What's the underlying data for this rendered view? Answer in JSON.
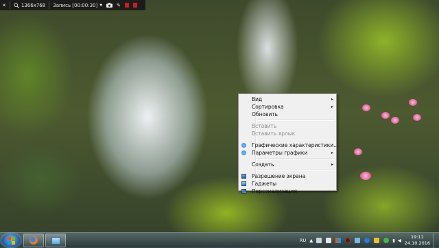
{
  "recorder": {
    "resolution": "1366x768",
    "record_label": "Запись [00:00:30]"
  },
  "context_menu": {
    "items": [
      {
        "label": "Вид",
        "submenu": true,
        "enabled": true
      },
      {
        "label": "Сортировка",
        "submenu": true,
        "enabled": true
      },
      {
        "label": "Обновить",
        "enabled": true
      },
      {
        "label": "Вставить",
        "enabled": false
      },
      {
        "label": "Вставить ярлык",
        "enabled": false
      },
      {
        "label": "Графические характеристики...",
        "icon": "intel-graphics-icon",
        "enabled": true
      },
      {
        "label": "Параметры графики",
        "icon": "intel-graphics-icon",
        "submenu": true,
        "enabled": true
      },
      {
        "label": "Создать",
        "submenu": true,
        "enabled": true
      },
      {
        "label": "Разрешение экрана",
        "icon": "screen-resolution-icon",
        "enabled": true
      },
      {
        "label": "Гаджеты",
        "icon": "gadgets-icon",
        "enabled": true
      },
      {
        "label": "Персонализация",
        "icon": "personalization-icon",
        "enabled": true
      }
    ],
    "submenu_arrow": "▸"
  },
  "taskbar": {
    "language": "RU",
    "clock": {
      "time": "19:11",
      "date": "24.10.2016"
    }
  },
  "colors": {
    "menu_bg": "#f0f0f0",
    "intel_icon": "#2a78d4",
    "taskbar": "#34474c"
  }
}
